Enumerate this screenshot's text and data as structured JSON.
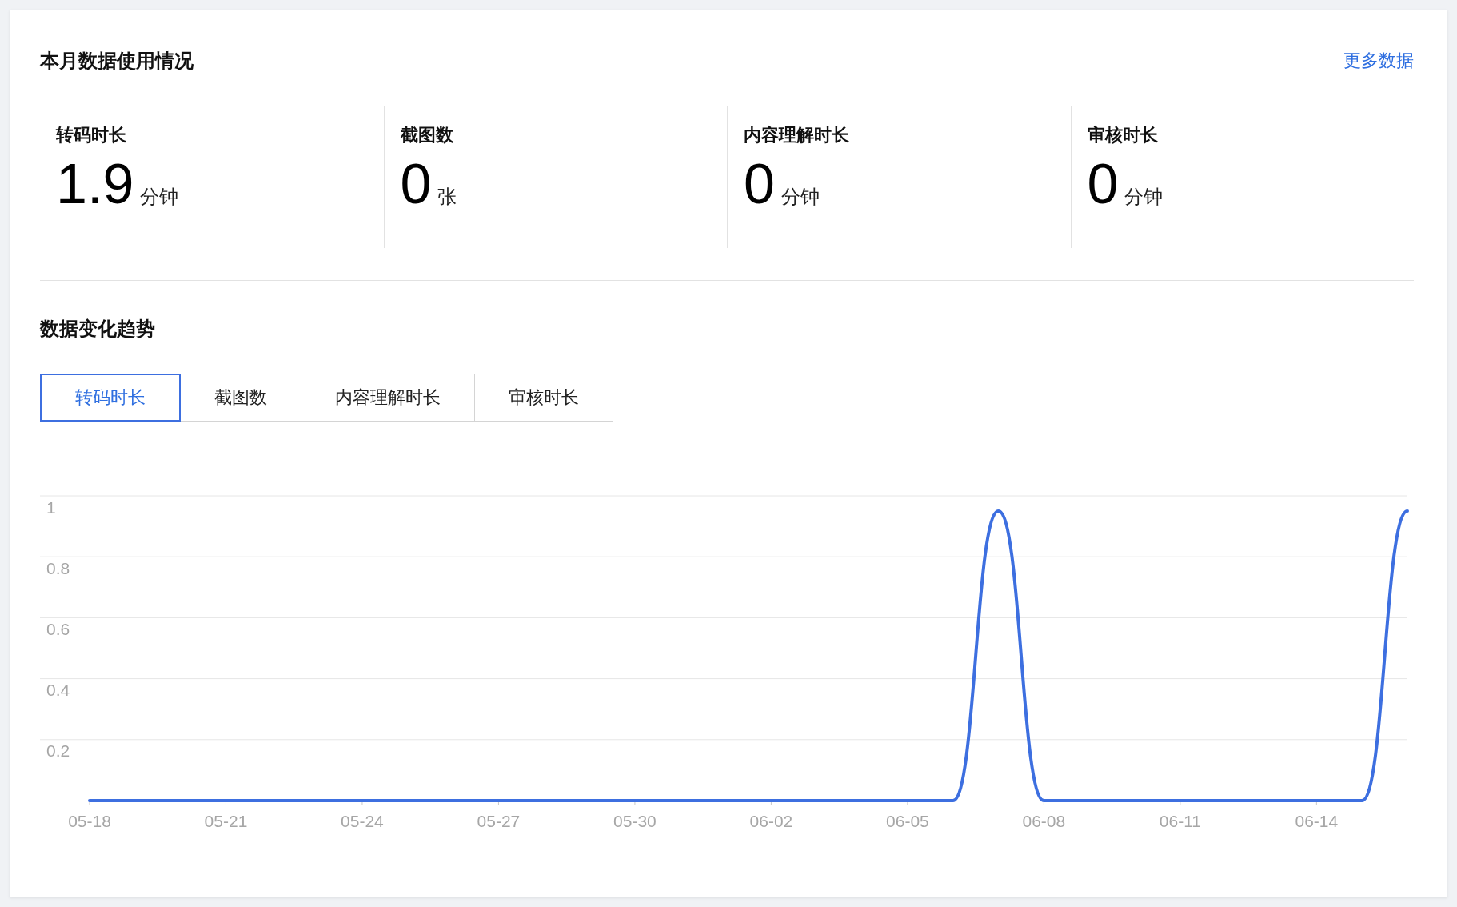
{
  "usage": {
    "title": "本月数据使用情况",
    "more_link": "更多数据",
    "stats": [
      {
        "label": "转码时长",
        "value": "1.9",
        "unit": "分钟"
      },
      {
        "label": "截图数",
        "value": "0",
        "unit": "张"
      },
      {
        "label": "内容理解时长",
        "value": "0",
        "unit": "分钟"
      },
      {
        "label": "审核时长",
        "value": "0",
        "unit": "分钟"
      }
    ]
  },
  "trend": {
    "title": "数据变化趋势",
    "tabs": [
      {
        "label": "转码时长",
        "selected": true
      },
      {
        "label": "截图数",
        "selected": false
      },
      {
        "label": "内容理解时长",
        "selected": false
      },
      {
        "label": "审核时长",
        "selected": false
      }
    ],
    "chart_data": {
      "type": "line",
      "categories": [
        "05-18",
        null,
        null,
        "05-21",
        null,
        null,
        "05-24",
        null,
        null,
        "05-27",
        null,
        null,
        "05-30",
        null,
        null,
        "06-02",
        null,
        null,
        "06-05",
        null,
        null,
        "06-08",
        null,
        null,
        "06-11",
        null,
        null,
        "06-14",
        null,
        null
      ],
      "grid": true,
      "series": [
        {
          "color": "#3d6fe0",
          "values": [
            0,
            0,
            0,
            0,
            0,
            0,
            0,
            0,
            0,
            0,
            0,
            0,
            0,
            0,
            0,
            0,
            0,
            0,
            0,
            0,
            0.95,
            0,
            0,
            0,
            0,
            0,
            0,
            0,
            0,
            0.95
          ]
        }
      ],
      "ylim": [
        0,
        1
      ],
      "yticks": [
        0.2,
        0.4,
        0.6,
        0.8,
        1
      ]
    }
  }
}
